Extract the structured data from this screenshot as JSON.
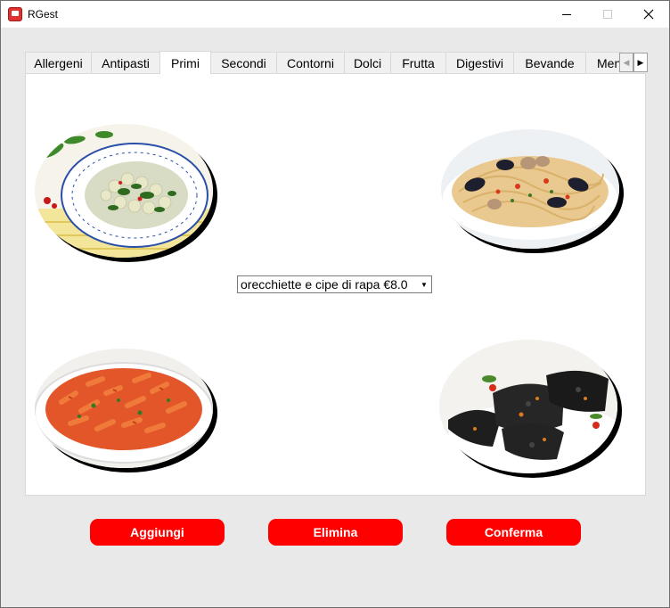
{
  "window": {
    "title": "RGest",
    "minimize_icon": "minimize-icon",
    "maximize_icon": "maximize-icon",
    "close_icon": "close-icon"
  },
  "tabs": [
    {
      "label": "Allergeni"
    },
    {
      "label": "Antipasti"
    },
    {
      "label": "Primi",
      "active": true
    },
    {
      "label": "Secondi"
    },
    {
      "label": "Contorni"
    },
    {
      "label": "Dolci"
    },
    {
      "label": "Frutta"
    },
    {
      "label": "Digestivi"
    },
    {
      "label": "Bevande"
    },
    {
      "label": "Menù"
    }
  ],
  "tab_scroll": {
    "left_icon": "arrow-left-icon",
    "right_icon": "arrow-right-icon"
  },
  "dish_select": {
    "selected": "orecchiette e cipe di rapa €8.0"
  },
  "dish_images": [
    {
      "icon": "orecchiette-cime-di-rapa-photo"
    },
    {
      "icon": "seafood-linguine-photo"
    },
    {
      "icon": "penne-arrabbiata-photo"
    },
    {
      "icon": "black-ravioli-photo"
    }
  ],
  "actions": {
    "add": "Aggiungi",
    "delete": "Elimina",
    "confirm": "Conferma"
  },
  "colors": {
    "button": "#ff0000",
    "button_text": "#ffffff"
  }
}
